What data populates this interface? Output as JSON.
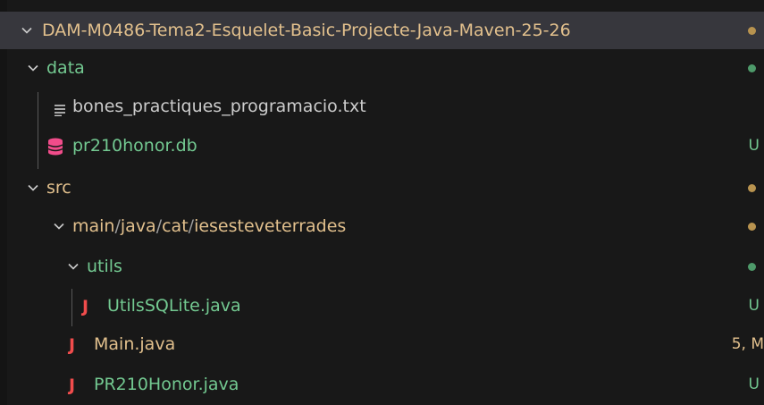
{
  "colors": {
    "background": "#181818",
    "selected_row": "#37373d",
    "modified_text": "#e2c08d",
    "untracked_text": "#73c991",
    "plain_text": "#cccccc",
    "database_icon": "#f14c8a",
    "java_icon": "#f14c4c",
    "guide_line": "#585858",
    "separator": "#9e9e9e"
  },
  "tree": {
    "root": {
      "label": "DAM-M0486-Tema2-Esquelet-Basic-Projecte-Java-Maven-25-26",
      "icon": "chevron-down-icon",
      "decoration": "modified-dot"
    },
    "data_folder": {
      "label": "data",
      "icon": "chevron-down-icon",
      "decoration": "untracked-dot"
    },
    "txt_file": {
      "label": "bones_practiques_programacio.txt",
      "icon": "text-file-icon"
    },
    "db_file": {
      "label": "pr210honor.db",
      "icon": "database-icon",
      "badge": "U"
    },
    "src_folder": {
      "label": "src",
      "icon": "chevron-down-icon",
      "decoration": "modified-dot"
    },
    "package_folder": {
      "segments": [
        "main",
        "java",
        "cat",
        "iesesteveterrades"
      ],
      "separator": "/",
      "icon": "chevron-down-icon",
      "decoration": "modified-dot"
    },
    "utils_folder": {
      "label": "utils",
      "icon": "chevron-down-icon",
      "decoration": "untracked-dot"
    },
    "utils_file": {
      "label": "UtilsSQLite.java",
      "icon": "java-icon",
      "badge": "U"
    },
    "main_file": {
      "label": "Main.java",
      "icon": "java-icon",
      "badge": "5, M"
    },
    "honor_file": {
      "label": "PR210Honor.java",
      "icon": "java-icon",
      "badge": "U"
    }
  }
}
